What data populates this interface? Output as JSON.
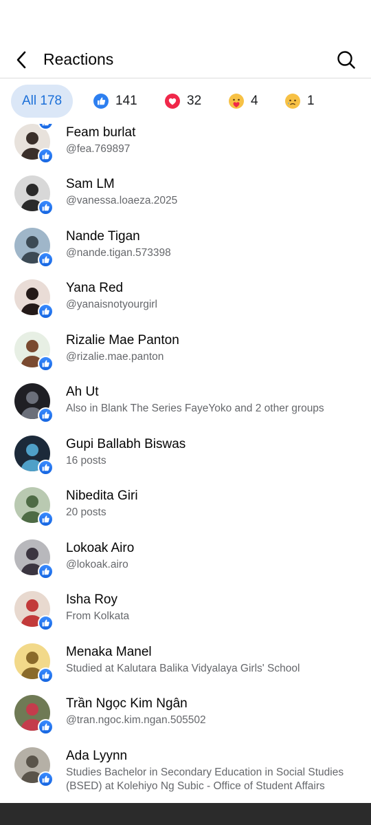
{
  "header": {
    "title": "Reactions",
    "back_icon": "chevron-left-icon",
    "search_icon": "search-icon"
  },
  "tabs": [
    {
      "label": "All 178",
      "active": true
    },
    {
      "emoji": "like",
      "count": "141"
    },
    {
      "emoji": "love",
      "count": "32"
    },
    {
      "emoji": "care",
      "count": "4"
    },
    {
      "emoji": "sad",
      "count": "1"
    }
  ],
  "people": [
    {
      "name": "Feam burlat",
      "sub": "@fea.769897",
      "bg": "#e8e2dc",
      "fg": "#3a2f2a"
    },
    {
      "name": "Sam LM",
      "sub": "@vanessa.loaeza.2025",
      "bg": "#d8d8d8",
      "fg": "#2a2a2a"
    },
    {
      "name": "Nande Tigan",
      "sub": "@nande.tigan.573398",
      "bg": "#9fb6c9",
      "fg": "#3c4a55"
    },
    {
      "name": "Yana Red",
      "sub": "@yanaisnotyourgirl",
      "bg": "#e9dcd6",
      "fg": "#241a18"
    },
    {
      "name": "Rizalie Mae Panton",
      "sub": "@rizalie.mae.panton",
      "bg": "#e7efe4",
      "fg": "#7a4a30"
    },
    {
      "name": "Ah Ut",
      "sub": "Also in Blank The Series FayeYoko and 2 other groups",
      "bg": "#1f1f24",
      "fg": "#6b6f7a"
    },
    {
      "name": "Gupi Ballabh Biswas",
      "sub": "16 posts",
      "bg": "#1c2a3a",
      "fg": "#4fa0c8"
    },
    {
      "name": "Nibedita Giri",
      "sub": "20 posts",
      "bg": "#b9c9b1",
      "fg": "#4e6b45"
    },
    {
      "name": "Lokoak Airo",
      "sub": "@lokoak.airo",
      "bg": "#b8b8bc",
      "fg": "#3b3540"
    },
    {
      "name": "Isha Roy",
      "sub": "From Kolkata",
      "bg": "#e8d9cf",
      "fg": "#c23a3a"
    },
    {
      "name": "Menaka Manel",
      "sub": "Studied at Kalutara Balika Vidyalaya Girls' School",
      "bg": "#f2d98a",
      "fg": "#8a6a2a"
    },
    {
      "name": "Trần Ngọc Kim Ngân",
      "sub": "@tran.ngoc.kim.ngan.505502",
      "bg": "#6f7a55",
      "fg": "#c43c4c"
    },
    {
      "name": "Ada Lyynn",
      "sub": "Studies Bachelor in Secondary Education in Social Studies (BSED) at Kolehiyo Ng Subic - Office of Student Affairs",
      "bg": "#b5b0a6",
      "fg": "#5a544a"
    }
  ]
}
